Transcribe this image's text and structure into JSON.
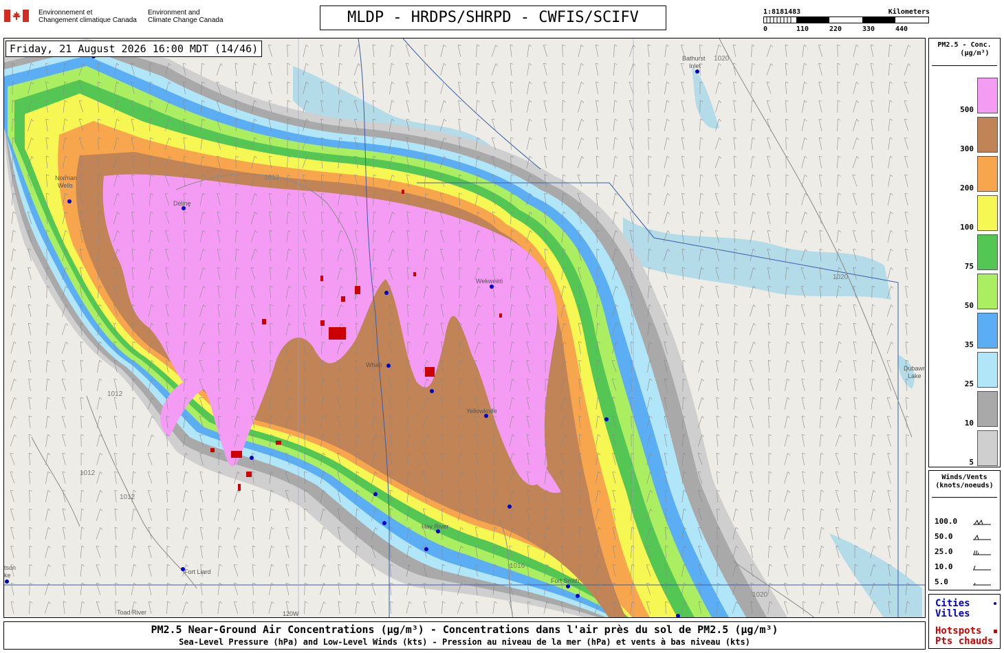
{
  "header": {
    "gov_fr_line1": "Environnement et",
    "gov_fr_line2": "Changement climatique Canada",
    "gov_en_line1": "Environment and",
    "gov_en_line2": "Climate Change Canada",
    "title": "MLDP - HRDPS/SHRPD - CWFIS/SCIFV",
    "scale": {
      "ratio": "1:8181483",
      "unit": "Kilometers",
      "ticks": [
        "0",
        "110",
        "220",
        "330",
        "440"
      ]
    }
  },
  "map": {
    "timestamp": "Friday, 21 August 2026 16:00 MDT (14/46)",
    "places": [
      {
        "name": "Bathurst",
        "name2": "Inlet"
      },
      {
        "name": "Norman",
        "name2": "Wells"
      },
      {
        "name": "Délįnę",
        "name2": ""
      },
      {
        "name": "Wekweètì",
        "name2": ""
      },
      {
        "name": "Whatì",
        "name2": ""
      },
      {
        "name": "Yellowknife",
        "name2": ""
      },
      {
        "name": "Hay River",
        "name2": ""
      },
      {
        "name": "Fort Smith",
        "name2": ""
      },
      {
        "name": "Fort Liard",
        "name2": ""
      },
      {
        "name": "Toad River",
        "name2": ""
      },
      {
        "name": "Dubawnt",
        "name2": "Lake"
      },
      {
        "name": "tson",
        "name2": "ke"
      }
    ],
    "isobars": [
      "1012",
      "1020",
      "1016"
    ],
    "meridian_label": "120W"
  },
  "legend_concentration": {
    "title_line1": "PM2.5 - Conc.",
    "title_line2": "(µg/m³)",
    "levels": [
      {
        "label": "500",
        "color": "#f49cf4"
      },
      {
        "label": "300",
        "color": "#c08456"
      },
      {
        "label": "200",
        "color": "#f7a64e"
      },
      {
        "label": "100",
        "color": "#f7f754"
      },
      {
        "label": "75",
        "color": "#54c654"
      },
      {
        "label": "50",
        "color": "#acee62"
      },
      {
        "label": "35",
        "color": "#5caef4"
      },
      {
        "label": "25",
        "color": "#b0e6f8"
      },
      {
        "label": "10",
        "color": "#a9a9a9"
      },
      {
        "label": "5",
        "color": "#cfcfcf"
      }
    ]
  },
  "legend_wind": {
    "title_line1": "Winds/Vents",
    "title_line2": "(knots/noeuds)",
    "rows": [
      "100.0",
      "50.0",
      "25.0",
      "10.0",
      "5.0"
    ]
  },
  "legend_points": {
    "cities_en": "Cities",
    "cities_fr": "Villes",
    "city_color": "#0000cc",
    "hotspots_en": "Hotspots",
    "hotspots_fr": "Pts chauds",
    "hotspot_color": "#cc0000"
  },
  "caption": {
    "line1": "PM2.5 Near-Ground Air Concentrations (µg/m³) - Concentrations dans l'air près du sol de PM2.5 (µg/m³)",
    "line2": "Sea-Level Pressure (hPa) and Low-Level Winds (kts) - Pression au niveau de la mer (hPa) et vents à bas niveau (kts)"
  }
}
